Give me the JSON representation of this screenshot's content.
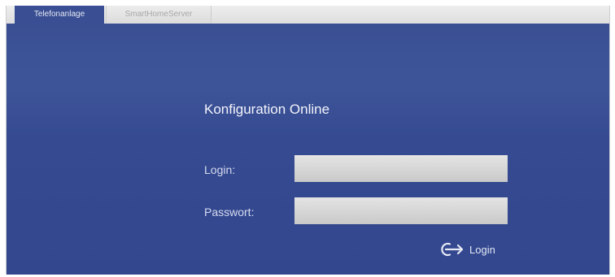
{
  "tabs": [
    {
      "label": "Telefonanlage",
      "active": true
    },
    {
      "label": "SmartHomeServer",
      "active": false
    }
  ],
  "main": {
    "title": "Konfiguration Online",
    "login_label": "Login:",
    "login_value": "",
    "password_label": "Passwort:",
    "password_value": "",
    "submit_label": "Login",
    "submit_icon": "login-arrow-icon"
  },
  "colors": {
    "panel_blue": "#3a4f92",
    "input_gray": "#d4d4d4",
    "tab_active_text": "#e6e9f5",
    "tab_inactive_text": "#a8a8a8"
  }
}
